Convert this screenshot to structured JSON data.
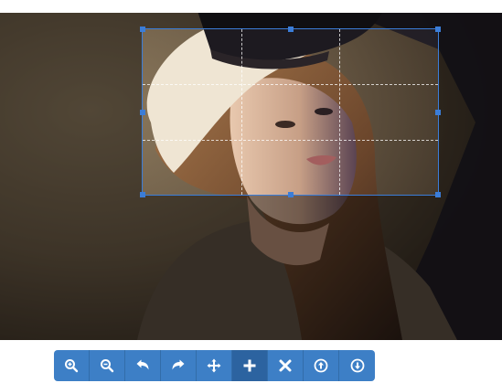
{
  "crop_guides": {
    "rows": 3,
    "cols": 3
  },
  "toolbar": {
    "buttons": [
      {
        "name": "zoom-in-button",
        "icon": "zoom-in-icon",
        "active": false
      },
      {
        "name": "zoom-out-button",
        "icon": "zoom-out-icon",
        "active": false
      },
      {
        "name": "rotate-left-button",
        "icon": "rotate-left-icon",
        "active": false
      },
      {
        "name": "rotate-right-button",
        "icon": "rotate-right-icon",
        "active": false
      },
      {
        "name": "move-mode-button",
        "icon": "arrows-move-icon",
        "active": false
      },
      {
        "name": "crop-mode-button",
        "icon": "plus-icon",
        "active": true
      },
      {
        "name": "clear-button",
        "icon": "close-icon",
        "active": false
      },
      {
        "name": "upload-button",
        "icon": "arrow-up-circle-icon",
        "active": false
      },
      {
        "name": "download-button",
        "icon": "arrow-down-circle-icon",
        "active": false
      }
    ]
  },
  "colors": {
    "toolbar_button": "#3d7fc6",
    "toolbar_button_active": "#2c63a0",
    "crop_outline": "#3b7dd8",
    "guide_lines": "#ffffff"
  }
}
